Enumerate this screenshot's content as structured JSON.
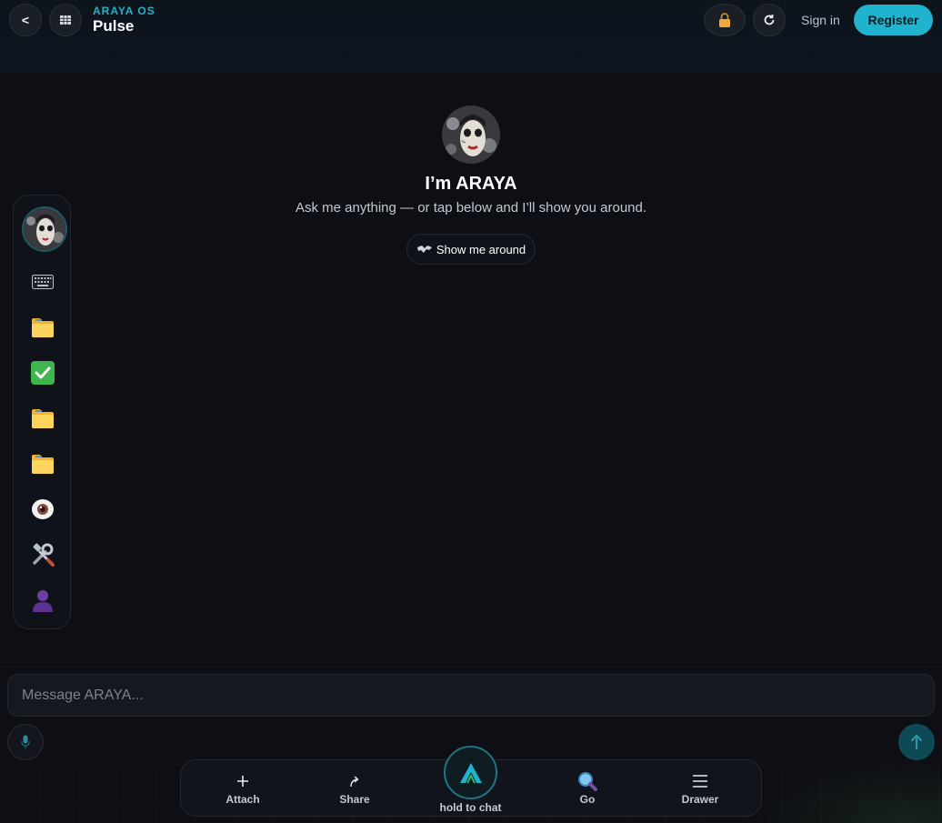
{
  "header": {
    "back_label": "<",
    "brand": "ARAYA OS",
    "title": "Pulse",
    "sign_in": "Sign in",
    "register": "Register"
  },
  "hero": {
    "title": "I’m ARAYA",
    "subtitle": "Ask me anything — or tap below and I’ll show you around.",
    "tour_button": "Show me around"
  },
  "sidebar": {
    "items": [
      {
        "icon": "avatar-icon"
      },
      {
        "icon": "keyboard-icon"
      },
      {
        "icon": "folder-icon"
      },
      {
        "icon": "checkbox-icon"
      },
      {
        "icon": "folder-icon"
      },
      {
        "icon": "folder-icon"
      },
      {
        "icon": "eye-icon"
      },
      {
        "icon": "tools-icon"
      },
      {
        "icon": "user-icon"
      }
    ]
  },
  "composer": {
    "placeholder": "Message ARAYA..."
  },
  "bottom_nav": {
    "attach": "Attach",
    "share": "Share",
    "center": "hold to chat",
    "go": "Go",
    "drawer": "Drawer"
  },
  "colors": {
    "accent": "#1fb3cd",
    "background": "#0d0f14"
  }
}
